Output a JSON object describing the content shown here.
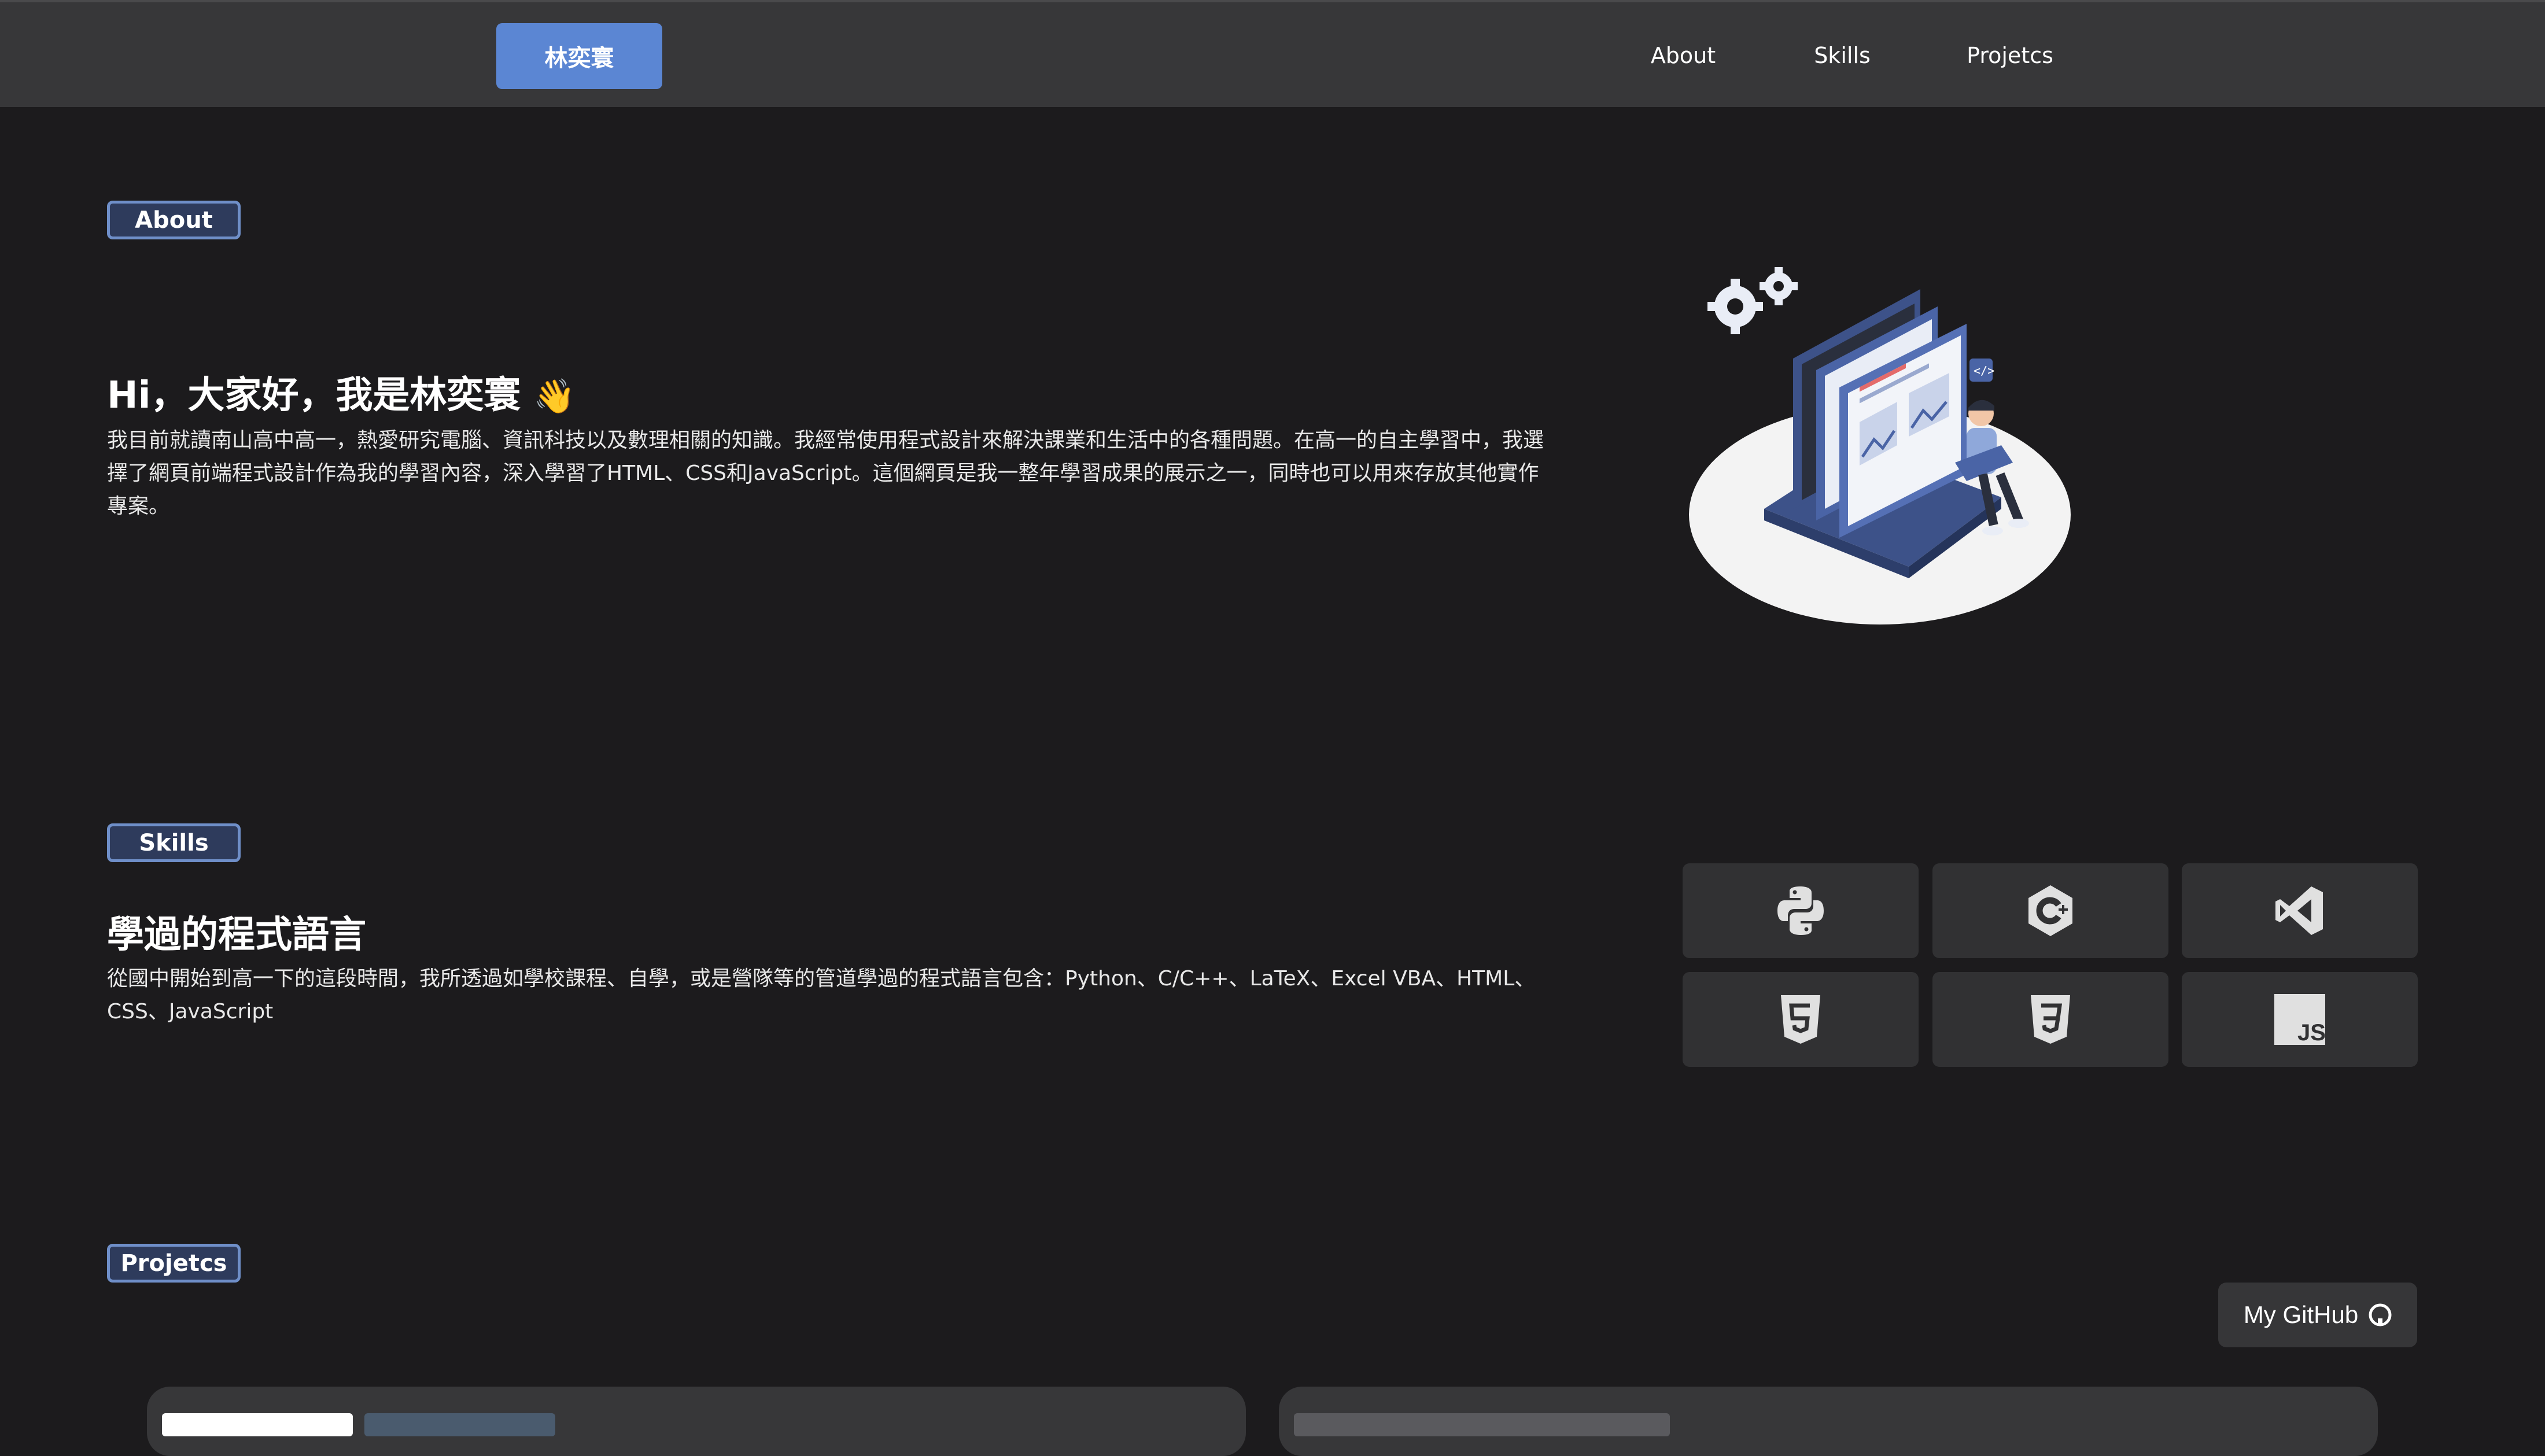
{
  "navbar": {
    "brand": "林奕寰",
    "links": [
      "About",
      "Skills",
      "Projetcs"
    ]
  },
  "about": {
    "badge": "About",
    "headline": "Hi，大家好，我是林奕寰",
    "wave_emoji": "👋",
    "paragraph_lines": [
      "我目前就讀南山高中高一，熱愛研究電腦、資訊科技以及數理相關的知識。我經常使用程式設計來解決課業和生活中的各種問題。在高一的自主學習中，我選",
      "擇了網頁前端程式設計作為我的學習內容，深入學習了HTML、CSS和JavaScript。這個網頁是我一整年學習成果的展示之一，同時也可以用來存放其他實作",
      "專案。"
    ]
  },
  "skills": {
    "badge": "Skills",
    "headline": "學過的程式語言",
    "paragraph_lines": [
      "從國中開始到高一下的這段時間，我所透過如學校課程、自學，或是營隊等的管道學過的程式語言包含：Python、C/C++、LaTeX、Excel VBA、HTML、",
      "CSS、JavaScript"
    ],
    "icons": [
      "python-icon",
      "c-plus-plus-icon",
      "vscode-icon",
      "html5-icon",
      "css3-icon",
      "javascript-icon"
    ],
    "js_label": "JS"
  },
  "projects": {
    "badge": "Projetcs",
    "github_button": "My GitHub"
  },
  "colors": {
    "background": "#1c1b1d",
    "navbar": "#373739",
    "accent": "#5b86d3",
    "tile": "#313133"
  }
}
